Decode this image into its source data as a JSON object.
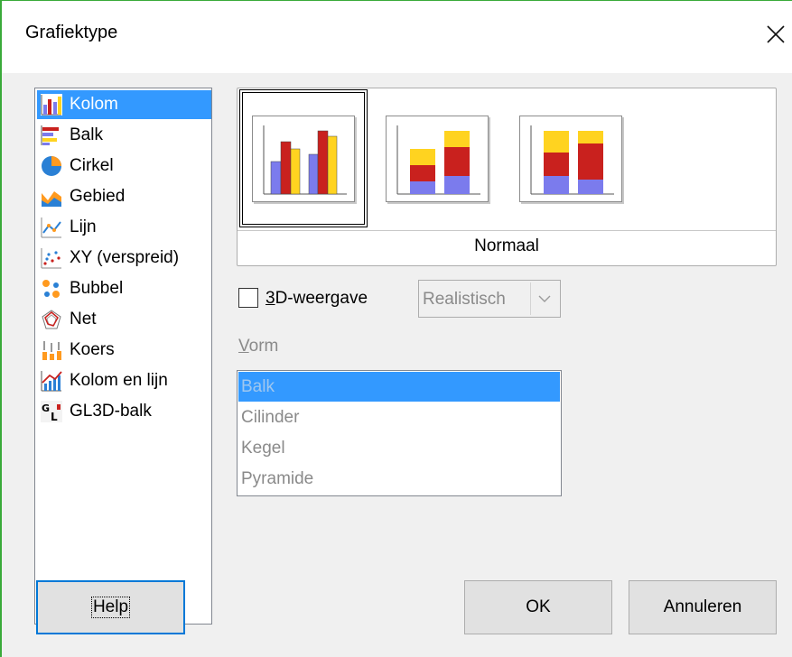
{
  "window": {
    "title": "Grafiektype",
    "close_glyph": "✕"
  },
  "chart_types": [
    {
      "label": "Kolom",
      "icon": "column-chart-icon",
      "selected": true
    },
    {
      "label": "Balk",
      "icon": "bar-chart-icon",
      "selected": false
    },
    {
      "label": "Cirkel",
      "icon": "pie-chart-icon",
      "selected": false
    },
    {
      "label": "Gebied",
      "icon": "area-chart-icon",
      "selected": false
    },
    {
      "label": "Lijn",
      "icon": "line-chart-icon",
      "selected": false
    },
    {
      "label": "XY (verspreid)",
      "icon": "scatter-chart-icon",
      "selected": false
    },
    {
      "label": "Bubbel",
      "icon": "bubble-chart-icon",
      "selected": false
    },
    {
      "label": "Net",
      "icon": "net-chart-icon",
      "selected": false
    },
    {
      "label": "Koers",
      "icon": "stock-chart-icon",
      "selected": false
    },
    {
      "label": "Kolom en lijn",
      "icon": "column-line-chart-icon",
      "selected": false
    },
    {
      "label": "GL3D-balk",
      "icon": "gl3d-bar-icon",
      "selected": false
    }
  ],
  "variants": {
    "selected_caption": "Normaal",
    "items": [
      {
        "icon": "normal-column-variant-icon",
        "selected": true
      },
      {
        "icon": "stacked-column-variant-icon",
        "selected": false
      },
      {
        "icon": "percent-stacked-column-variant-icon",
        "selected": false
      }
    ]
  },
  "three_d": {
    "checked": false,
    "label_mnemonic": "3",
    "label_rest": "D-weergave",
    "style_value": "Realistisch"
  },
  "shape": {
    "label_mnemonic": "V",
    "label_rest": "orm",
    "items": [
      "Balk",
      "Cilinder",
      "Kegel",
      "Pyramide"
    ],
    "selected_index": 0
  },
  "buttons": {
    "help": "Help",
    "ok": "OK",
    "cancel": "Annuleren"
  },
  "colors": {
    "selection": "#3399ff",
    "bar_blue": "#7b7bed",
    "bar_red": "#c9211e",
    "bar_yellow": "#ffd320"
  }
}
